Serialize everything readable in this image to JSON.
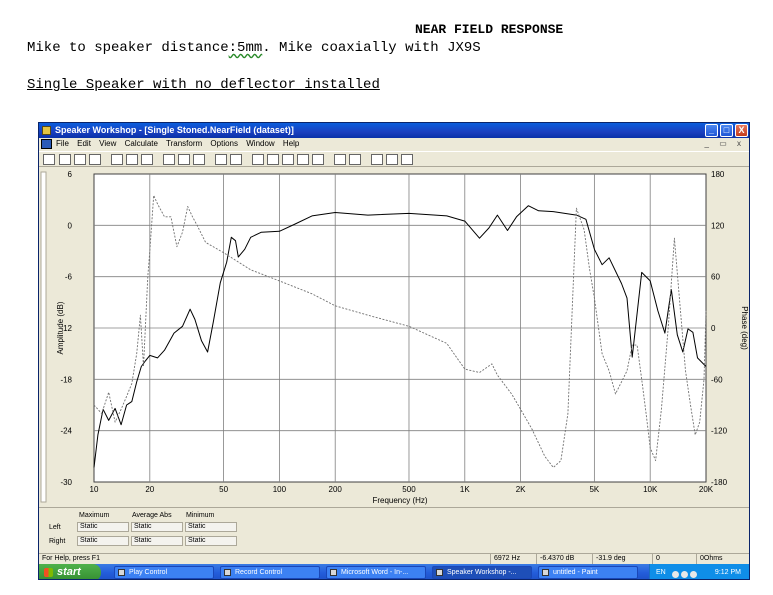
{
  "document": {
    "title": "NEAR FIELD RESPONSE",
    "desc_prefix": "Mike to speaker distance",
    "desc_squiggle": ":5mm",
    "desc_suffix": ". Mike coaxially with JX9S",
    "subtitle": "Single Speaker with no deflector installed"
  },
  "window": {
    "title": "Speaker Workshop - [Single Stoned.NearField (dataset)]",
    "buttons": {
      "minimize": "_",
      "maximize": "□",
      "close": "X"
    },
    "mdi_controls": "_ ▭ x"
  },
  "menu": [
    "File",
    "Edit",
    "View",
    "Calculate",
    "Transform",
    "Options",
    "Window",
    "Help"
  ],
  "summary": {
    "headers": [
      "Maximum",
      "Average Abs",
      "Minimum"
    ],
    "rows": [
      {
        "label": "Left",
        "values": [
          "Static",
          "Static",
          "Static"
        ]
      },
      {
        "label": "Right",
        "values": [
          "Static",
          "Static",
          "Static"
        ]
      }
    ]
  },
  "status": {
    "help": "For Help, press F1",
    "freq": "6972 Hz",
    "amp": "-6.4370 dB",
    "phase": "-31.9 deg",
    "val": "0",
    "ohms": "0Ohms"
  },
  "taskbar": {
    "start": "start",
    "tasks": [
      "Play Control",
      "Record Control",
      "Microsoft Word - In-...",
      "Speaker Workshop -...",
      "untitled - Paint"
    ],
    "lang": "EN",
    "clock": "9:12 PM"
  },
  "colors": {
    "titlebar": "#0a5ddc",
    "taskbar": "#245edb",
    "plot_bg": "#ffffff",
    "grid": "#808080"
  },
  "chart_data": {
    "type": "line",
    "xlabel": "Frequency (Hz)",
    "ylabel": "Amplitude (dB)",
    "y2label": "Phase (deg)",
    "x_scale": "log",
    "xlim": [
      10,
      20000
    ],
    "ylim": [
      -30,
      6
    ],
    "y2lim": [
      -180,
      180
    ],
    "x_ticks": [
      10,
      20,
      50,
      100,
      200,
      500,
      1000,
      2000,
      5000,
      10000,
      20000
    ],
    "x_tick_labels": [
      "10",
      "20",
      "50",
      "100",
      "200",
      "500",
      "1K",
      "2K",
      "5K",
      "10K",
      "20K"
    ],
    "y_ticks": [
      6,
      0,
      -6,
      -12,
      -18,
      -24,
      -30
    ],
    "y2_ticks": [
      180,
      120,
      60,
      0,
      -60,
      -120,
      -180
    ],
    "grid": true,
    "series": [
      {
        "axis": "left",
        "style": "solid",
        "points": [
          [
            10,
            -28.3
          ],
          [
            10.5,
            -24.5
          ],
          [
            11.2,
            -21.5
          ],
          [
            12,
            -22.8
          ],
          [
            13,
            -21.4
          ],
          [
            14,
            -23.3
          ],
          [
            15,
            -21
          ],
          [
            16,
            -20.6
          ],
          [
            17,
            -18.3
          ],
          [
            18,
            -16.5
          ],
          [
            19,
            -15.8
          ],
          [
            20,
            -15.2
          ],
          [
            22,
            -15.5
          ],
          [
            24,
            -14.6
          ],
          [
            27,
            -12.6
          ],
          [
            30,
            -11.8
          ],
          [
            33,
            -9.8
          ],
          [
            35,
            -11
          ],
          [
            38,
            -13.5
          ],
          [
            41,
            -14.8
          ],
          [
            44,
            -11.3
          ],
          [
            48,
            -6.7
          ],
          [
            52,
            -4.3
          ],
          [
            55,
            -1.4
          ],
          [
            58,
            -1.8
          ],
          [
            60,
            -3.7
          ],
          [
            65,
            -2.8
          ],
          [
            70,
            -1.4
          ],
          [
            80,
            -0.8
          ],
          [
            100,
            -0.7
          ],
          [
            120,
            0.1
          ],
          [
            150,
            1.1
          ],
          [
            200,
            1.5
          ],
          [
            300,
            1.2
          ],
          [
            500,
            1.4
          ],
          [
            800,
            1.1
          ],
          [
            1000,
            0.5
          ],
          [
            1200,
            -1.5
          ],
          [
            1350,
            -0.3
          ],
          [
            1500,
            1.2
          ],
          [
            1700,
            -0.6
          ],
          [
            1900,
            1
          ],
          [
            2200,
            2.3
          ],
          [
            2500,
            1.7
          ],
          [
            3000,
            1.6
          ],
          [
            4000,
            1.2
          ],
          [
            4500,
            0.7
          ],
          [
            5000,
            -2.8
          ],
          [
            5500,
            -4.6
          ],
          [
            6000,
            -3.8
          ],
          [
            7000,
            -6.8
          ],
          [
            7500,
            -8.5
          ],
          [
            8000,
            -15.4
          ],
          [
            9000,
            -5.5
          ],
          [
            10000,
            -6.5
          ],
          [
            11000,
            -10
          ],
          [
            12000,
            -12.6
          ],
          [
            13000,
            -7.5
          ],
          [
            14000,
            -12.8
          ],
          [
            15000,
            -14.8
          ],
          [
            16000,
            -12.1
          ],
          [
            17000,
            -12.5
          ],
          [
            18000,
            -15.5
          ],
          [
            20000,
            -16.5
          ]
        ]
      },
      {
        "axis": "right",
        "style": "dashed",
        "points": [
          [
            10,
            -90
          ],
          [
            11,
            -100
          ],
          [
            12,
            -75
          ],
          [
            13,
            -110
          ],
          [
            14,
            -95
          ],
          [
            15,
            -80
          ],
          [
            16,
            -65
          ],
          [
            17,
            -30
          ],
          [
            17.8,
            15
          ],
          [
            18.5,
            -45
          ],
          [
            19.5,
            60
          ],
          [
            20,
            90
          ],
          [
            21,
            155
          ],
          [
            22,
            145
          ],
          [
            24,
            130
          ],
          [
            26,
            130
          ],
          [
            28,
            95
          ],
          [
            30,
            112
          ],
          [
            32,
            142
          ],
          [
            34,
            130
          ],
          [
            36,
            120
          ],
          [
            40,
            100
          ],
          [
            50,
            88
          ],
          [
            70,
            68
          ],
          [
            100,
            55
          ],
          [
            150,
            40
          ],
          [
            200,
            26
          ],
          [
            300,
            15
          ],
          [
            500,
            2
          ],
          [
            800,
            -18
          ],
          [
            1000,
            -48
          ],
          [
            1200,
            -52
          ],
          [
            1400,
            -42
          ],
          [
            1500,
            -55
          ],
          [
            1800,
            -78
          ],
          [
            2000,
            -95
          ],
          [
            2300,
            -118
          ],
          [
            2700,
            -150
          ],
          [
            3000,
            -163
          ],
          [
            3300,
            -155
          ],
          [
            3600,
            -100
          ],
          [
            4000,
            140
          ],
          [
            4400,
            115
          ],
          [
            4700,
            70
          ],
          [
            5000,
            35
          ],
          [
            5500,
            -30
          ],
          [
            6000,
            -50
          ],
          [
            6500,
            -77
          ],
          [
            7000,
            -63
          ],
          [
            7500,
            -50
          ],
          [
            8000,
            -20
          ],
          [
            8500,
            -20
          ],
          [
            9000,
            -60
          ],
          [
            9500,
            -100
          ],
          [
            10000,
            -140
          ],
          [
            10700,
            -155
          ],
          [
            11500,
            -95
          ],
          [
            12500,
            0
          ],
          [
            13500,
            105
          ],
          [
            14500,
            25
          ],
          [
            15500,
            -50
          ],
          [
            16500,
            -90
          ],
          [
            17500,
            -125
          ],
          [
            18500,
            -110
          ],
          [
            19500,
            -60
          ],
          [
            20000,
            20
          ]
        ]
      }
    ]
  }
}
